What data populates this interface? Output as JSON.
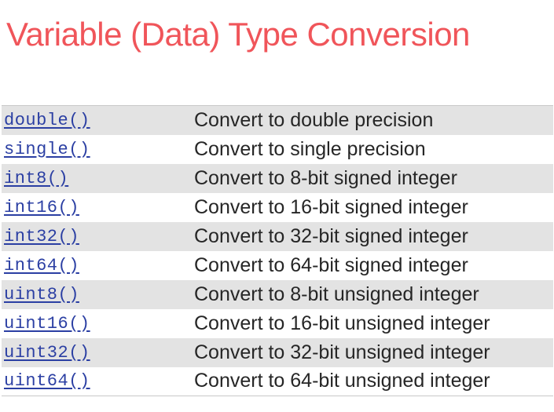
{
  "slide": {
    "title": "Variable (Data) Type Conversion"
  },
  "rows": [
    {
      "function": "double()",
      "description": "Convert to double precision"
    },
    {
      "function": "single()",
      "description": "Convert to single precision"
    },
    {
      "function": "int8()",
      "description": "Convert to 8-bit signed integer"
    },
    {
      "function": "int16()",
      "description": "Convert to 16-bit signed integer"
    },
    {
      "function": "int32()",
      "description": "Convert to 32-bit signed integer"
    },
    {
      "function": "int64()",
      "description": "Convert to 64-bit signed integer"
    },
    {
      "function": "uint8()",
      "description": "Convert to 8-bit unsigned integer"
    },
    {
      "function": "uint16()",
      "description": "Convert to 16-bit unsigned integer"
    },
    {
      "function": "uint32()",
      "description": "Convert to 32-bit unsigned integer"
    },
    {
      "function": "uint64()",
      "description": "Convert to 64-bit unsigned integer"
    }
  ],
  "colors": {
    "title": "#f0555a",
    "link": "#2b3fa3",
    "stripe": "#e3e3e3"
  }
}
